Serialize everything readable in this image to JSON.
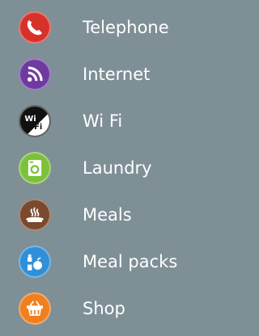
{
  "amenities": [
    {
      "label": "Telephone",
      "icon": "telephone-icon",
      "color": "#d6322b"
    },
    {
      "label": "Internet",
      "icon": "wifi-signal-icon",
      "color": "#6f3aa0"
    },
    {
      "label": "Wi Fi",
      "icon": "wi-fi-badge-icon",
      "color": "#111111"
    },
    {
      "label": "Laundry",
      "icon": "washing-machine-icon",
      "color": "#7cc13a"
    },
    {
      "label": "Meals",
      "icon": "hot-plate-icon",
      "color": "#7a4a2e"
    },
    {
      "label": "Meal packs",
      "icon": "bottle-apple-icon",
      "color": "#2f8fd8"
    },
    {
      "label": "Shop",
      "icon": "shopping-basket-icon",
      "color": "#f07f1f"
    }
  ],
  "icon_text": {
    "wifi_wi": "Wi",
    "wifi_fi": "Fi"
  }
}
